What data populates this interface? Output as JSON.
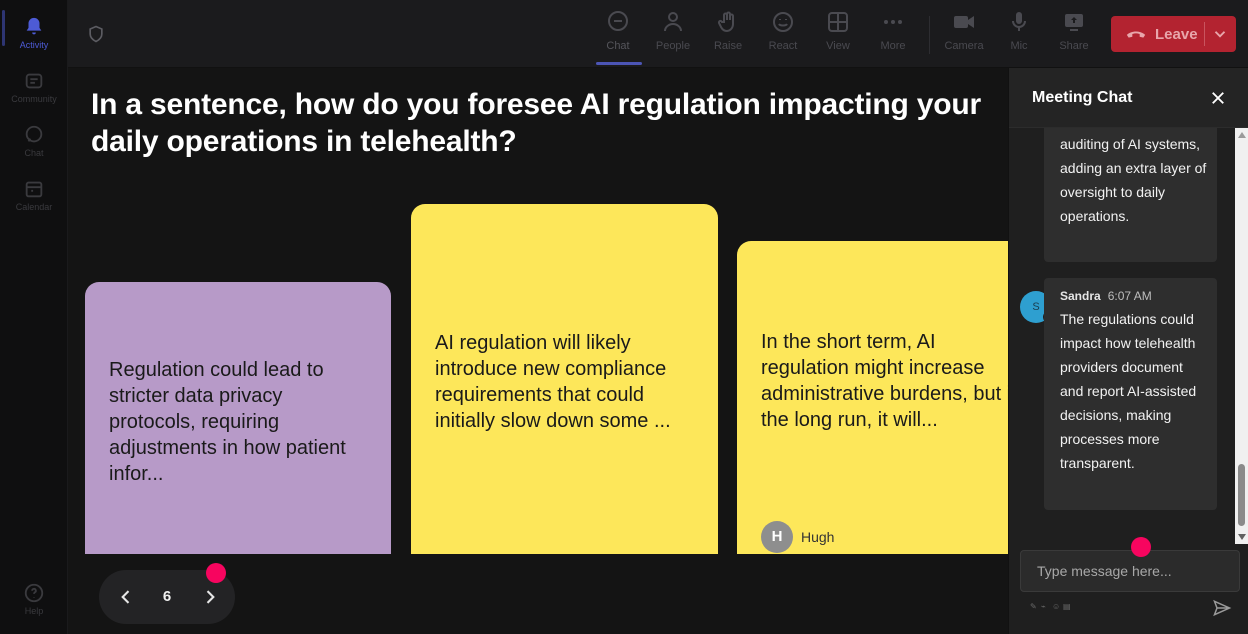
{
  "rail": {
    "items": [
      {
        "label": "Activity",
        "icon": "bell-icon"
      },
      {
        "label": "Community",
        "icon": "community-icon"
      },
      {
        "label": "Chat",
        "icon": "chat-icon"
      },
      {
        "label": "Calendar",
        "icon": "calendar-icon"
      }
    ],
    "help": {
      "label": "Help",
      "icon": "help-icon"
    }
  },
  "toolbar": {
    "chat": "Chat",
    "people": "People",
    "raise": "Raise",
    "react": "React",
    "view": "View",
    "more": "More",
    "camera": "Camera",
    "mic": "Mic",
    "share": "Share",
    "leave": "Leave"
  },
  "stage": {
    "question": "In a sentence, how do you foresee AI regulation impacting your daily operations in telehealth?",
    "cards": [
      {
        "text": "Regulation could lead to stricter data privacy protocols, requiring adjustments in how patient infor...",
        "color": "#b79ac8"
      },
      {
        "text": "AI regulation will likely introduce new compliance requirements that could initially slow down some ...",
        "color": "#fde75a"
      },
      {
        "text": "In the short term, AI regulation might increase administrative burdens, but in the long run, it will...",
        "color": "#fde75a",
        "author": "Hugh",
        "author_initial": "H"
      }
    ],
    "pager": {
      "page": "6"
    }
  },
  "chat": {
    "title": "Meeting Chat",
    "messages": [
      {
        "text": "auditing of AI systems, adding an extra layer of oversight to daily operations."
      },
      {
        "sender": "Sandra",
        "initial": "S",
        "time": "6:07 AM",
        "text": "The regulations could impact how telehealth providers document and report AI-assisted decisions, making processes more transparent."
      }
    ],
    "compose_placeholder": "Type message here..."
  },
  "colors": {
    "accent": "#4d5bd6",
    "leave": "#b32330",
    "highlight_dot": "#f7055f",
    "sticky_yellow": "#fde75a",
    "sticky_purple": "#b79ac8"
  }
}
